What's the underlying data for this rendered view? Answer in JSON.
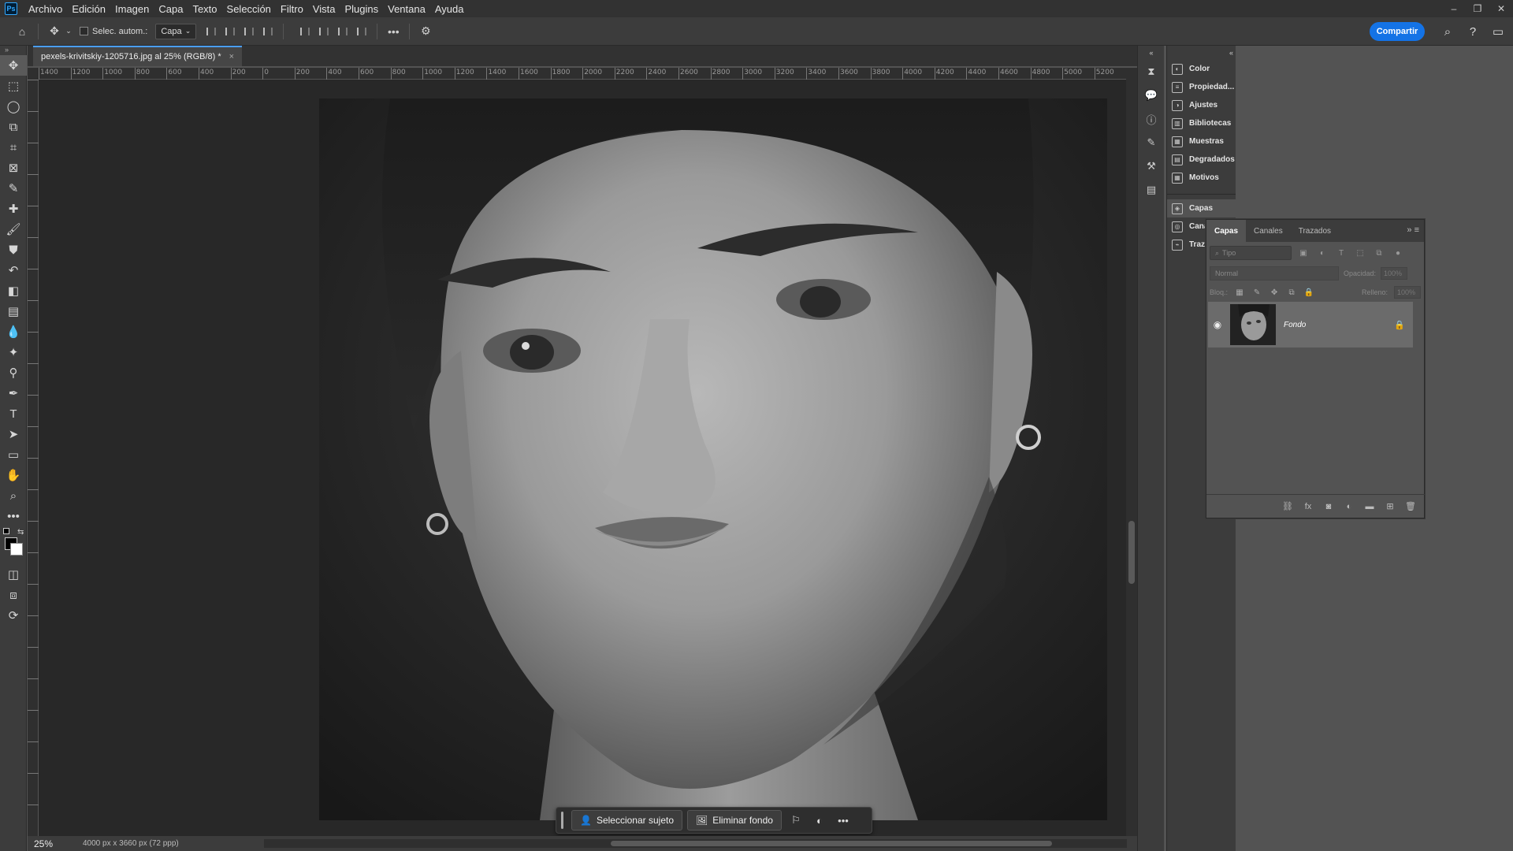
{
  "app": {
    "logo": "Ps"
  },
  "menu": [
    "Archivo",
    "Edición",
    "Imagen",
    "Capa",
    "Texto",
    "Selección",
    "Filtro",
    "Vista",
    "Plugins",
    "Ventana",
    "Ayuda"
  ],
  "window_controls": {
    "minimize": "–",
    "restore": "❐",
    "close": "✕"
  },
  "options": {
    "auto_select_label": "Selec. autom.:",
    "auto_select_checked": false,
    "layer_target": "Capa",
    "share_label": "Compartir"
  },
  "document": {
    "tab_title": "pexels-krivitskiy-1205716.jpg al 25% (RGB/8) *",
    "close_symbol": "×"
  },
  "ruler": {
    "h_labels": [
      "1400",
      "1200",
      "1000",
      "800",
      "600",
      "400",
      "200",
      "0",
      "200",
      "400",
      "600",
      "800",
      "1000",
      "1200",
      "1400",
      "1600",
      "1800",
      "2000",
      "2200",
      "2400",
      "2600",
      "2800",
      "3000",
      "3200",
      "3400",
      "3600",
      "3800",
      "4000",
      "4200",
      "4400",
      "4600",
      "4800",
      "5000",
      "5200"
    ]
  },
  "taskbar": {
    "select_subject": "Seleccionar sujeto",
    "remove_background": "Eliminar fondo"
  },
  "status": {
    "zoom": "25%",
    "doc_info": "4000 px x 3660 px (72 ppp)"
  },
  "right_panels": {
    "group1": [
      {
        "label": "Color",
        "icon": "color-icon"
      },
      {
        "label": "Propiedad...",
        "icon": "properties-icon"
      },
      {
        "label": "Ajustes",
        "icon": "adjustments-icon"
      },
      {
        "label": "Bibliotecas",
        "icon": "libraries-icon"
      },
      {
        "label": "Muestras",
        "icon": "swatches-icon"
      },
      {
        "label": "Degradados",
        "icon": "gradients-icon"
      },
      {
        "label": "Motivos",
        "icon": "patterns-icon"
      }
    ],
    "group2": [
      {
        "label": "Capas",
        "icon": "layers-icon"
      },
      {
        "label": "Canales",
        "icon": "channels-icon"
      },
      {
        "label": "Trazados",
        "icon": "paths-icon"
      }
    ]
  },
  "layers_panel": {
    "tabs": [
      "Capas",
      "Canales",
      "Trazados"
    ],
    "filter_placeholder": "Tipo",
    "blend_mode": "Normal",
    "opacity_label": "Opacidad:",
    "opacity_value": "100%",
    "lock_label": "Bloq.:",
    "fill_label": "Relleno:",
    "fill_value": "100%",
    "layers": [
      {
        "name": "Fondo",
        "visible": true,
        "locked": true
      }
    ]
  }
}
